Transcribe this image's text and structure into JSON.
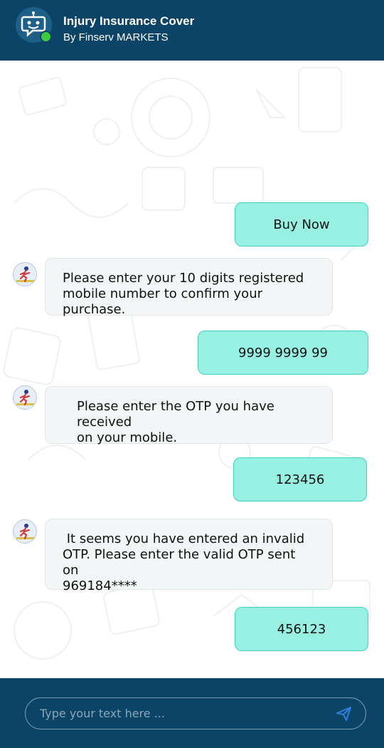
{
  "header": {
    "title": "Injury Insurance Cover",
    "subtitle": "By Finserv MARKETS",
    "bot_icon": "chatbot-icon",
    "status": "online",
    "status_color": "#3fc93f"
  },
  "messages": [
    {
      "from": "user",
      "text": "Buy Now"
    },
    {
      "from": "bot",
      "lines": [
        "Please enter your 10 digits registered",
        "mobile number to confirm your purchase."
      ]
    },
    {
      "from": "user",
      "text": "9999 9999 99"
    },
    {
      "from": "bot",
      "lines": [
        "Please enter the OTP you have received",
        "on your mobile."
      ]
    },
    {
      "from": "user",
      "text": "123456"
    },
    {
      "from": "bot",
      "lines": [
        " It seems you have entered an invalid",
        "OTP. Please enter the valid OTP sent on",
        "969184****"
      ]
    },
    {
      "from": "user",
      "text": "456123"
    }
  ],
  "composer": {
    "placeholder": "Type your text here ...",
    "send_icon": "send-icon"
  },
  "colors": {
    "header_bg": "#0b4466",
    "user_bubble": "#97f0e2",
    "bot_bubble": "#f3f6f7",
    "accent": "#2f7fe0"
  }
}
